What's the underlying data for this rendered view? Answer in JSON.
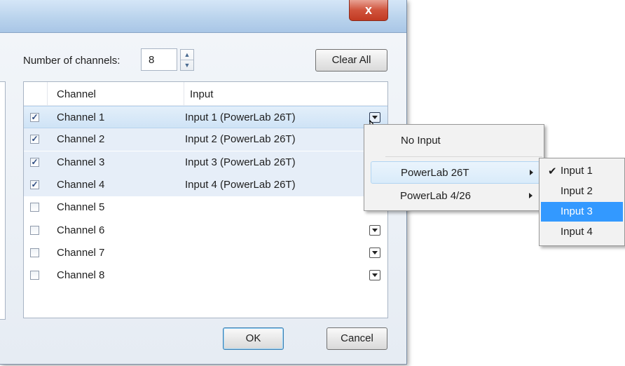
{
  "dialog": {
    "close_label": "x",
    "channels_label": "Number of channels:",
    "channels_value": "8",
    "clear_all_label": "Clear All",
    "ok_label": "OK",
    "cancel_label": "Cancel"
  },
  "grid": {
    "headers": {
      "channel": "Channel",
      "input": "Input"
    },
    "rows": [
      {
        "checked": true,
        "name": "Channel 1",
        "input": "Input 1 (PowerLab 26T)",
        "selected": true
      },
      {
        "checked": true,
        "name": "Channel 2",
        "input": "Input 2 (PowerLab 26T)"
      },
      {
        "checked": true,
        "name": "Channel 3",
        "input": "Input 3 (PowerLab 26T)"
      },
      {
        "checked": true,
        "name": "Channel 4",
        "input": "Input 4 (PowerLab 26T)"
      },
      {
        "checked": false,
        "name": "Channel 5",
        "input": ""
      },
      {
        "checked": false,
        "name": "Channel 6",
        "input": ""
      },
      {
        "checked": false,
        "name": "Channel 7",
        "input": ""
      },
      {
        "checked": false,
        "name": "Channel 8",
        "input": ""
      }
    ]
  },
  "context_menu": {
    "items": [
      "No Input",
      "PowerLab 26T",
      "PowerLab 4/26"
    ],
    "hovered_item": "PowerLab 26T"
  },
  "submenu": {
    "items": [
      "Input 1",
      "Input 2",
      "Input 3",
      "Input 4"
    ],
    "checked_item": "Input 1",
    "highlighted_item": "Input 3"
  },
  "colors": {
    "highlight": "#3399ff",
    "selected_row": "#cfe3f6",
    "close_button": "#c9452d"
  }
}
